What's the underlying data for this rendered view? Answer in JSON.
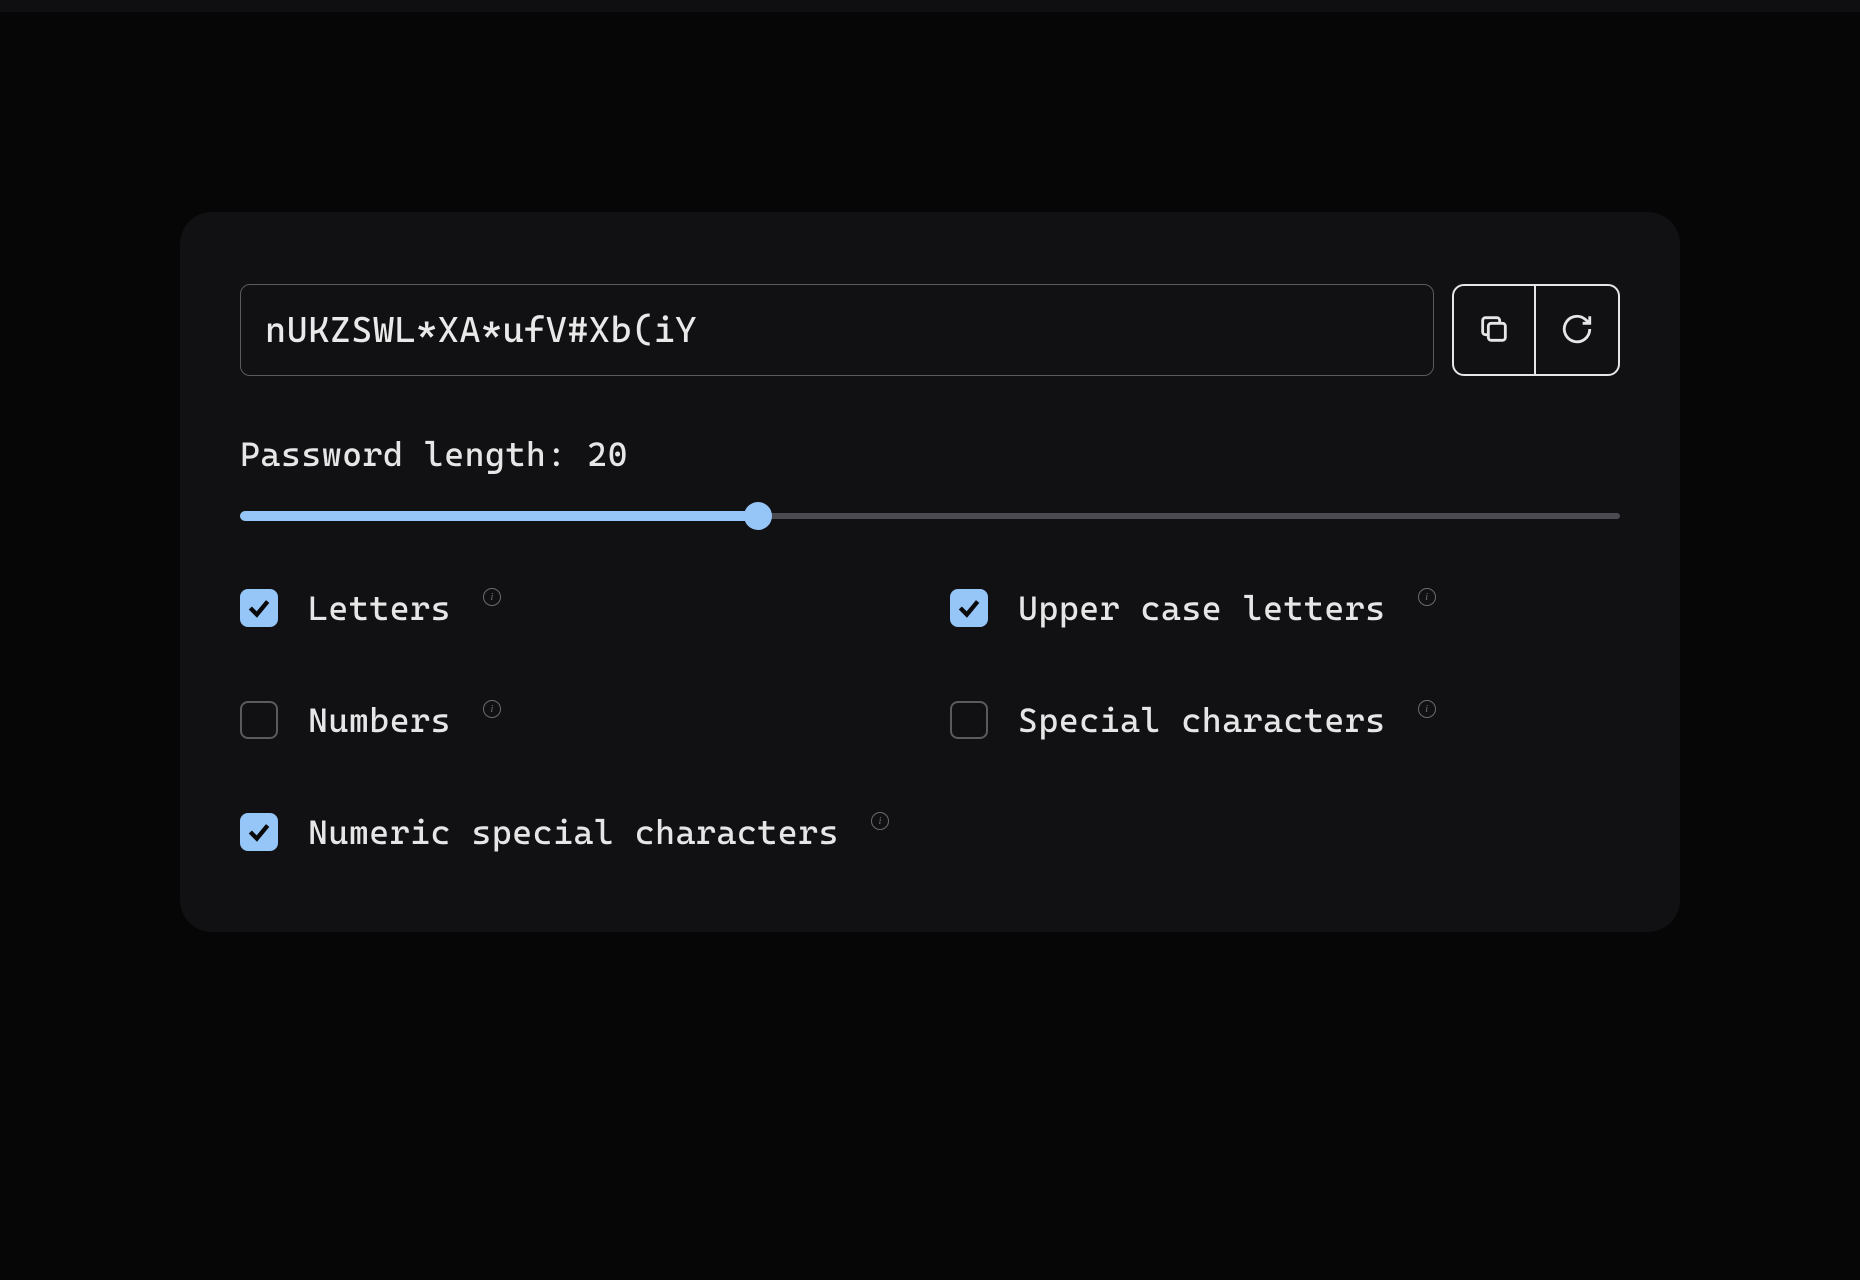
{
  "password": {
    "value": "nUKZSWL*XA*ufV#Xb(iY"
  },
  "length": {
    "label_prefix": "Password length: ",
    "value": 20,
    "min": 1,
    "max": 50,
    "fill_percent": 37.5
  },
  "options": [
    {
      "key": "letters",
      "label": "Letters",
      "checked": true
    },
    {
      "key": "uppercase",
      "label": "Upper case letters",
      "checked": true
    },
    {
      "key": "numbers",
      "label": "Numbers",
      "checked": false
    },
    {
      "key": "special",
      "label": "Special characters",
      "checked": false
    },
    {
      "key": "numeric_special",
      "label": "Numeric special characters",
      "checked": true
    }
  ],
  "icons": {
    "copy": "copy-icon",
    "refresh": "refresh-icon",
    "info": "i"
  }
}
